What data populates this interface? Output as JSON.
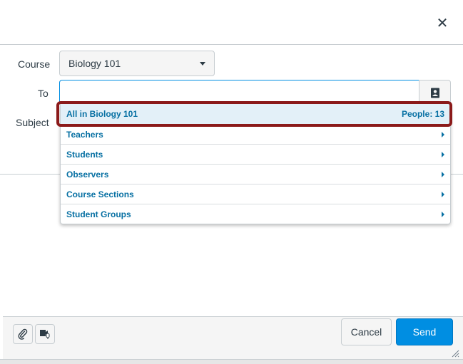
{
  "dialog": {
    "close_glyph": "✕"
  },
  "form": {
    "course_label": "Course",
    "course_value": "Biology 101",
    "to_label": "To",
    "to_value": "",
    "subject_label": "Subject"
  },
  "recipients": [
    {
      "label": "All in Biology 101",
      "meta": "People: 13",
      "highlighted": true
    },
    {
      "label": "Teachers",
      "has_submenu": true
    },
    {
      "label": "Students",
      "has_submenu": true
    },
    {
      "label": "Observers",
      "has_submenu": true
    },
    {
      "label": "Course Sections",
      "has_submenu": true
    },
    {
      "label": "Student Groups",
      "has_submenu": true
    }
  ],
  "footer": {
    "attach_icon": "paperclip-icon",
    "media_icon": "media-comment-icon",
    "cancel_label": "Cancel",
    "send_label": "Send"
  },
  "colors": {
    "accent": "#008ee2",
    "link": "#0770a3",
    "highlight_ring": "#8b1a1a",
    "highlight_bg": "#e3f0f8"
  }
}
